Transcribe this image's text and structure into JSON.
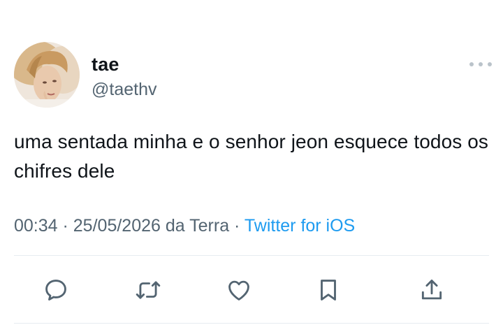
{
  "tweet": {
    "author": {
      "display_name": "tae",
      "handle": "@taethv"
    },
    "text": "uma sentada minha e o senhor jeon esquece todos os chifres dele",
    "time": "00:34",
    "separator": " · ",
    "date_location": "25/05/2026 da Terra",
    "source": "Twitter for iOS"
  },
  "icons": {
    "more": "more-horizontal-icon",
    "reply": "reply-icon",
    "retweet": "retweet-icon",
    "like": "heart-icon",
    "bookmark": "bookmark-icon",
    "share": "share-icon"
  },
  "colors": {
    "text": "#0f1419",
    "secondary": "#536471",
    "link": "#1d9bf0",
    "divider": "#e6ecf0"
  }
}
